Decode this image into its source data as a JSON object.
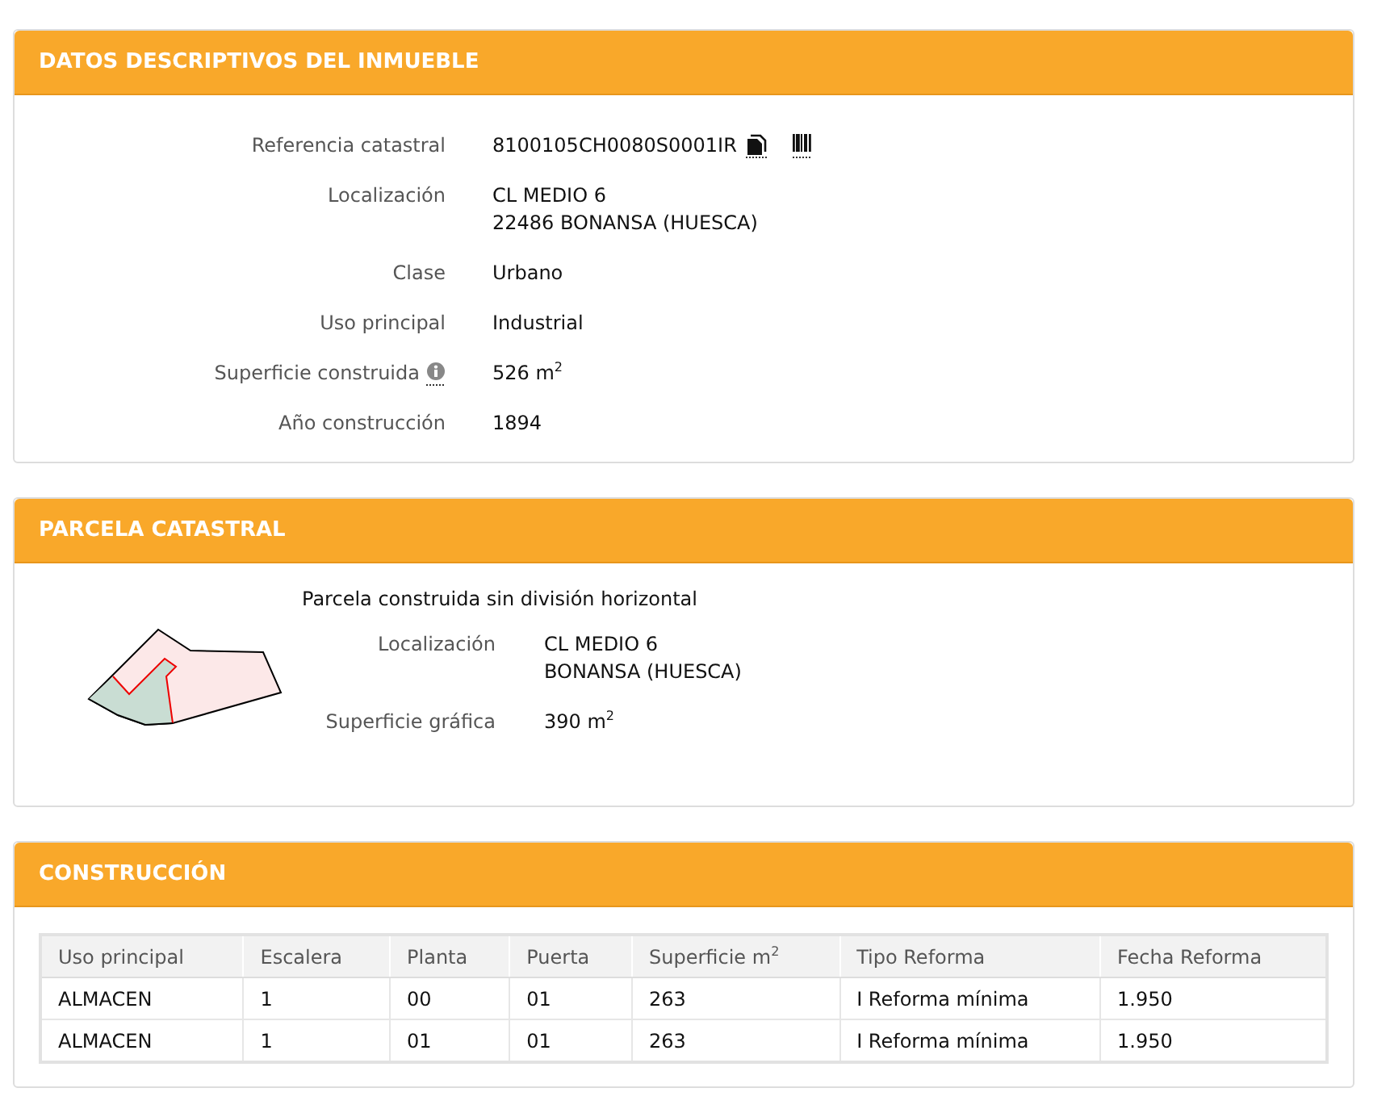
{
  "inmueble": {
    "title": "DATOS DESCRIPTIVOS DEL INMUEBLE",
    "rows": [
      {
        "kind": "ref",
        "label": "Referencia catastral",
        "lines": [
          "8100105CH0080S0001IR"
        ]
      },
      {
        "kind": "text",
        "label": "Localización",
        "lines": [
          "CL MEDIO 6",
          "22486 BONANSA (HUESCA)"
        ]
      },
      {
        "kind": "text",
        "label": "Clase",
        "lines": [
          "Urbano"
        ]
      },
      {
        "kind": "text",
        "label": "Uso principal",
        "lines": [
          "Industrial"
        ]
      },
      {
        "kind": "info",
        "label": "Superficie construida",
        "lines": [
          "526 m$^{2}$"
        ]
      },
      {
        "kind": "text",
        "label": "Año construcción",
        "lines": [
          "1894"
        ]
      }
    ]
  },
  "parcela": {
    "title": "PARCELA CATASTRAL",
    "subtitle": "Parcela construida sin división horizontal",
    "rows": [
      {
        "kind": "text",
        "label": "Localización",
        "lines": [
          "CL MEDIO 6",
          "BONANSA (HUESCA)"
        ]
      },
      {
        "kind": "text",
        "label": "Superficie gráfica",
        "lines": [
          "390 m$^{2}$"
        ]
      }
    ]
  },
  "construccion": {
    "title": "CONSTRUCCIÓN",
    "table": {
      "columns": [
        "Uso principal",
        "Escalera",
        "Planta",
        "Puerta",
        "Superficie m$^{2}$",
        "Tipo Reforma",
        "Fecha Reforma"
      ],
      "rows": [
        [
          "ALMACEN",
          "1",
          "00",
          "01",
          "263",
          "I Reforma mínima",
          "1.950"
        ],
        [
          "ALMACEN",
          "1",
          "01",
          "01",
          "263",
          "I Reforma mínima",
          "1.950"
        ]
      ]
    }
  }
}
